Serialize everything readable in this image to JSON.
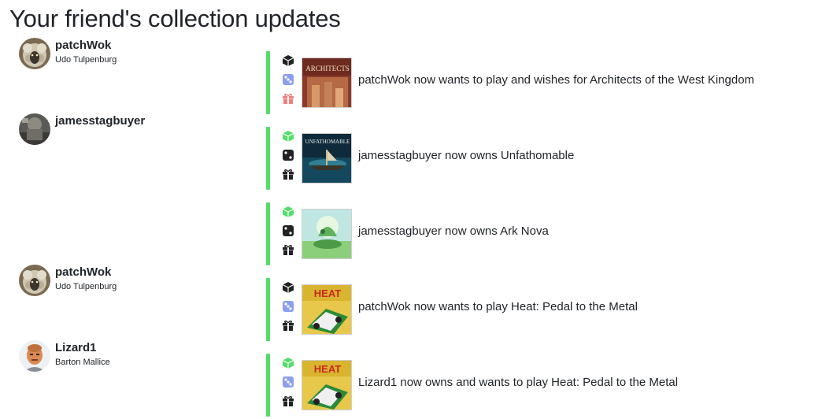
{
  "page": {
    "title": "Your friend's collection updates"
  },
  "colors": {
    "accent_bar": "#55dd6b",
    "icon_active_green": "#55dd6b",
    "icon_active_blue": "#8c9eef",
    "icon_active_red": "#f08080",
    "icon_inactive": "#222222"
  },
  "users": [
    {
      "username": "patchWok",
      "realname": "Udo Tulpenburg",
      "avatar": "sheep-avatar"
    },
    {
      "username": "jamesstagbuyer",
      "realname": "",
      "avatar": "photo-avatar"
    },
    {
      "username": "patchWok",
      "realname": "Udo Tulpenburg",
      "avatar": "sheep-avatar"
    },
    {
      "username": "Lizard1",
      "realname": "Barton Mallice",
      "avatar": "character-avatar"
    }
  ],
  "entries": [
    {
      "text": "patchWok now wants to play and wishes for Architects of the West Kingdom",
      "cover": "architects-cover",
      "cover_title": "ARCHITECTS",
      "owned": false,
      "want_to_play": true,
      "wishlist": true
    },
    {
      "text": "jamesstagbuyer now owns Unfathomable",
      "cover": "unfathomable-cover",
      "cover_title": "UNFATHOMABLE",
      "owned": true,
      "want_to_play": false,
      "wishlist": false
    },
    {
      "text": "jamesstagbuyer now owns Ark Nova",
      "cover": "ark-nova-cover",
      "cover_title": "",
      "owned": true,
      "want_to_play": false,
      "wishlist": false
    },
    {
      "text": "patchWok now wants to play Heat: Pedal to the Metal",
      "cover": "heat-cover",
      "cover_title": "HEAT",
      "owned": false,
      "want_to_play": true,
      "wishlist": false
    },
    {
      "text": "Lizard1 now owns and wants to play Heat: Pedal to the Metal",
      "cover": "heat-cover",
      "cover_title": "HEAT",
      "owned": true,
      "want_to_play": true,
      "wishlist": false
    }
  ]
}
